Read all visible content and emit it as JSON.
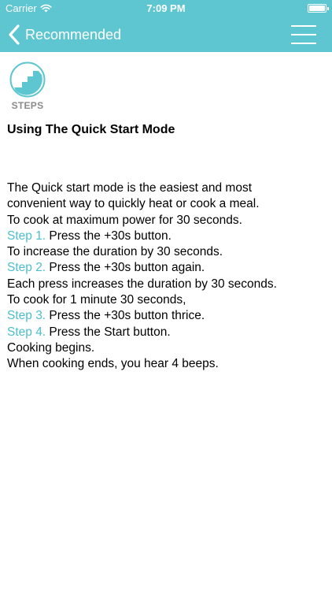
{
  "status_bar": {
    "carrier": "Carrier",
    "time": "7:09 PM"
  },
  "nav": {
    "back_label": "Recommended",
    "back_icon": "chevron-left-icon",
    "menu_icon": "hamburger-menu-icon"
  },
  "logo": {
    "icon": "steps-icon",
    "caption": "STEPS"
  },
  "article": {
    "title": "Using The Quick Start Mode",
    "intro_1": "The Quick start mode is the easiest and most",
    "intro_2": "convenient way to quickly heat or cook a meal.",
    "line_1": "To cook at maximum power for 30 seconds.",
    "step_1_label": "Step 1.",
    "step_1_text": " Press the +30s button.",
    "line_2": "To increase the duration by 30 seconds.",
    "step_2_label": "Step 2.",
    "step_2_text": " Press the +30s button again.",
    "line_3": "Each press increases the duration by 30 seconds.",
    "line_4": "To cook for 1 minute 30 seconds,",
    "step_3_label": "Step 3.",
    "step_3_text": " Press the +30s button thrice.",
    "step_4_label": "Step 4.",
    "step_4_text": " Press the Start button.",
    "line_5": "Cooking begins.",
    "line_6": "When cooking ends, you hear 4 beeps."
  },
  "colors": {
    "accent": "#5ec6d1",
    "step_label": "#4dbecb",
    "caption_gray": "#8a8a8a"
  }
}
